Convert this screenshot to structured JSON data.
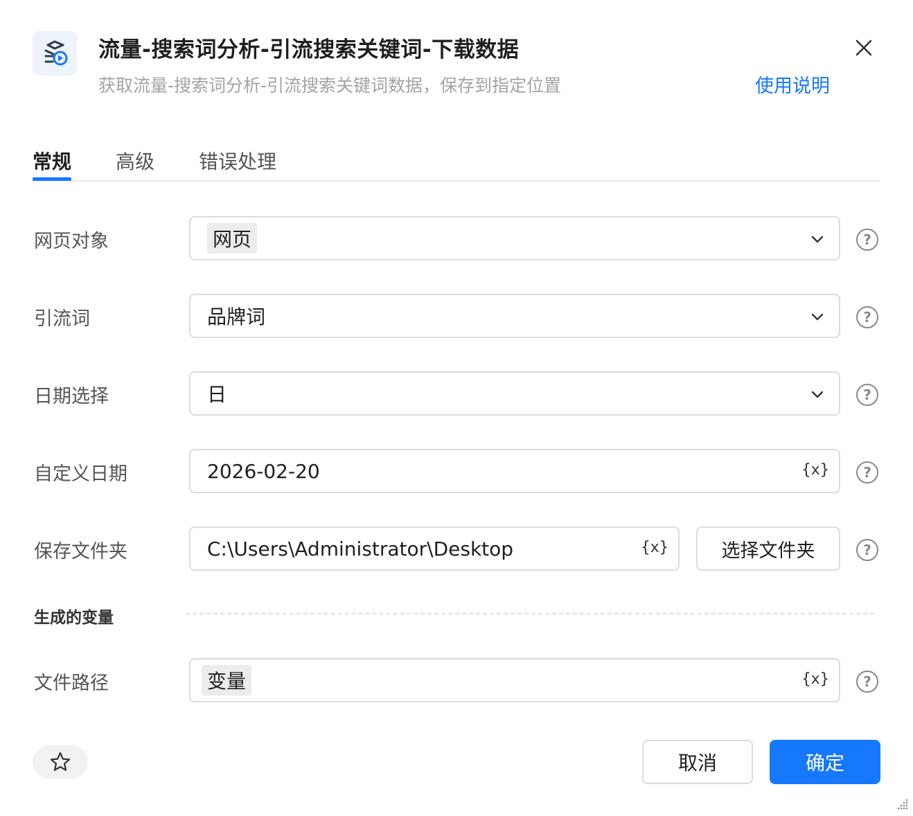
{
  "header": {
    "title": "流量-搜索词分析-引流搜索关键词-下载数据",
    "subtitle": "获取流量-搜索词分析-引流搜索关键词数据，保存到指定位置",
    "help_link": "使用说明",
    "app_icon": "layers-play-icon",
    "close_icon": "close-icon"
  },
  "tabs": [
    {
      "label": "常规",
      "active": true
    },
    {
      "label": "高级",
      "active": false
    },
    {
      "label": "错误处理",
      "active": false
    }
  ],
  "form": {
    "web_object": {
      "label": "网页对象",
      "value": "网页"
    },
    "traffic_word": {
      "label": "引流词",
      "value": "品牌词"
    },
    "date_select": {
      "label": "日期选择",
      "value": "日"
    },
    "custom_date": {
      "label": "自定义日期",
      "value": "2026-02-20"
    },
    "save_folder": {
      "label": "保存文件夹",
      "value": "C:\\Users\\Administrator\\Desktop",
      "button": "选择文件夹"
    },
    "variable_icon_text": "{x}",
    "help_mark": "?"
  },
  "generated": {
    "section_label": "生成的变量",
    "file_path": {
      "label": "文件路径",
      "value": "变量"
    }
  },
  "footer": {
    "cancel": "取消",
    "confirm": "确定",
    "favorite_icon": "star-icon"
  },
  "colors": {
    "accent": "#1677ff",
    "border": "#dcdcdc",
    "label": "#555555",
    "subtitle": "#a3a3a3"
  }
}
